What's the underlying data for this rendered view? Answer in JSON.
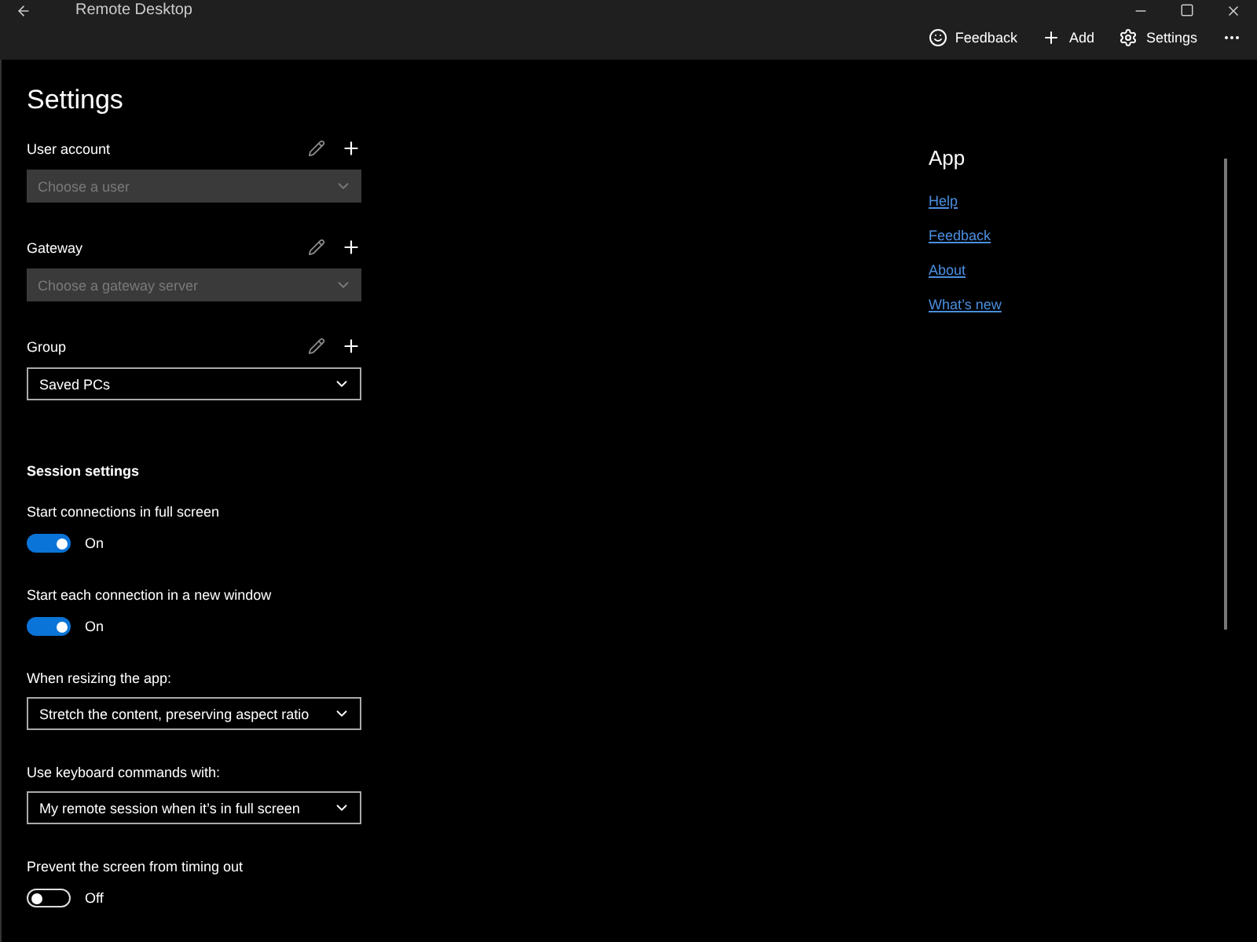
{
  "window": {
    "title": "Remote Desktop"
  },
  "toolbar": [
    {
      "kind": "feedback",
      "label": "Feedback"
    },
    {
      "kind": "add",
      "label": "Add"
    },
    {
      "kind": "settings",
      "label": "Settings"
    }
  ],
  "page_title": "Settings",
  "accounts": [
    {
      "label": "User account",
      "placeholder": "Choose a user",
      "disabled": true
    },
    {
      "label": "Gateway",
      "placeholder": "Choose a gateway server",
      "disabled": true
    },
    {
      "label": "Group",
      "value": "Saved PCs",
      "disabled": false
    }
  ],
  "session": {
    "heading": "Session settings",
    "items": [
      {
        "kind": "toggle",
        "label": "Start connections in full screen",
        "on": true,
        "state_label": "On"
      },
      {
        "kind": "toggle",
        "label": "Start each connection in a new window",
        "on": true,
        "state_label": "On"
      },
      {
        "kind": "dropdown",
        "label": "When resizing the app:",
        "value": "Stretch the content, preserving aspect ratio"
      },
      {
        "kind": "dropdown",
        "label": "Use keyboard commands with:",
        "value": "My remote session when it’s in full screen"
      },
      {
        "kind": "toggle",
        "label": "Prevent the screen from timing out",
        "on": false,
        "state_label": "Off"
      }
    ]
  },
  "app": {
    "heading": "App",
    "links": [
      "Help",
      "Feedback",
      "About",
      "What’s new"
    ]
  }
}
